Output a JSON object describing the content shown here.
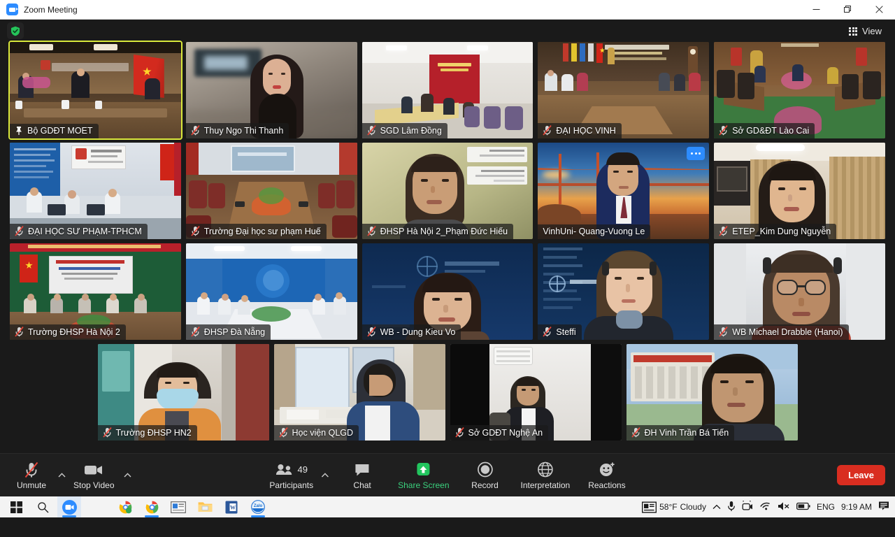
{
  "window": {
    "title": "Zoom Meeting",
    "app_icon": "zoom-video-icon",
    "minimize": "minimize-icon",
    "maximize": "restore-icon",
    "close": "close-icon"
  },
  "header": {
    "security_badge": "shield-check-icon",
    "view_label": "View",
    "view_icon": "grid-icon"
  },
  "gallery": {
    "rows": [
      [
        {
          "name": "Bộ GDĐT MOET",
          "status": "pinned",
          "active_speaker": true,
          "scene": "conf-room-flag",
          "more": false
        },
        {
          "name": "Thuy Ngo Thi Thanh",
          "status": "muted",
          "active_speaker": false,
          "scene": "person-woman-office",
          "more": false
        },
        {
          "name": "SGD Lâm Đồng",
          "status": "muted",
          "active_speaker": false,
          "scene": "room-red-banner",
          "more": false
        },
        {
          "name": "ĐẠI HỌC VINH",
          "status": "muted",
          "active_speaker": false,
          "scene": "room-vinh-univ",
          "more": false
        },
        {
          "name": "Sở GD&ĐT Lào Cai",
          "status": "muted",
          "active_speaker": false,
          "scene": "room-laocai",
          "more": false
        }
      ],
      [
        {
          "name": "ĐẠI HỌC SƯ PHẠM-TPHCM",
          "status": "muted",
          "active_speaker": false,
          "scene": "room-hcm-blue",
          "more": false
        },
        {
          "name": "Trường Đại học sư phạm Huế",
          "status": "muted",
          "active_speaker": false,
          "scene": "room-hue",
          "more": false
        },
        {
          "name": "ĐHSP Hà Nội 2_Phạm Đức Hiếu",
          "status": "muted",
          "active_speaker": false,
          "scene": "person-man-green",
          "more": false
        },
        {
          "name": "VinhUni- Quang-Vuong Le",
          "status": "unmuted",
          "active_speaker": false,
          "scene": "person-bridge-bg",
          "more": true
        },
        {
          "name": "ETEP_Kim Dung Nguyễn",
          "status": "muted",
          "active_speaker": false,
          "scene": "person-woman-curtain",
          "more": false
        }
      ],
      [
        {
          "name": "Trường ĐHSP Hà Nội 2",
          "status": "muted",
          "active_speaker": false,
          "scene": "room-banner-red",
          "more": false
        },
        {
          "name": "ĐHSP Đà Nẵng",
          "status": "muted",
          "active_speaker": false,
          "scene": "room-danang-blue",
          "more": false
        },
        {
          "name": "WB - Dung Kieu Vo",
          "status": "muted",
          "active_speaker": false,
          "scene": "person-worldbank-1",
          "more": false
        },
        {
          "name": "Steffi",
          "status": "muted",
          "active_speaker": false,
          "scene": "person-worldbank-2",
          "more": false
        },
        {
          "name": "WB Michael Drabble (Hanoi)",
          "status": "muted",
          "active_speaker": false,
          "scene": "person-glasses-headset",
          "more": false
        }
      ],
      [
        {
          "name": "Trường ĐHSP HN2",
          "status": "muted",
          "active_speaker": false,
          "scene": "person-woman-mask",
          "more": false
        },
        {
          "name": "Học viện QLGD",
          "status": "muted",
          "active_speaker": false,
          "scene": "room-desk-man",
          "more": false
        },
        {
          "name": "Sở GDĐT Nghệ An",
          "status": "muted",
          "active_speaker": false,
          "scene": "person-man-suit",
          "more": false
        },
        {
          "name": "ĐH Vinh Trần Bá Tiến",
          "status": "muted",
          "active_speaker": false,
          "scene": "person-man-building",
          "more": false
        }
      ]
    ]
  },
  "toolbar": {
    "mute": {
      "label": "Unmute",
      "icon": "microphone-muted-icon",
      "has_caret": true
    },
    "video": {
      "label": "Stop Video",
      "icon": "video-camera-icon",
      "has_caret": true
    },
    "participants": {
      "label": "Participants",
      "icon": "people-icon",
      "count": "49",
      "has_caret": true
    },
    "chat": {
      "label": "Chat",
      "icon": "chat-bubble-icon"
    },
    "share": {
      "label": "Share Screen",
      "icon": "share-arrow-up-icon",
      "accent": "#3ad07d"
    },
    "record": {
      "label": "Record",
      "icon": "record-circle-icon"
    },
    "interpretation": {
      "label": "Interpretation",
      "icon": "globe-icon"
    },
    "reactions": {
      "label": "Reactions",
      "icon": "smiley-plus-icon"
    },
    "leave": {
      "label": "Leave",
      "color": "#d92d20"
    }
  },
  "taskbar": {
    "items": [
      {
        "name": "start-button",
        "icon": "windows-logo-icon"
      },
      {
        "name": "search-button",
        "icon": "magnifier-icon"
      },
      {
        "name": "zoom-taskbar-button",
        "icon": "zoom-video-icon"
      },
      {
        "name": "chrome-green-taskbar-button",
        "icon": "chrome-icon"
      },
      {
        "name": "chrome-taskbar-button",
        "icon": "chrome-icon"
      },
      {
        "name": "news-widget-button",
        "icon": "news-panel-icon"
      },
      {
        "name": "file-explorer-button",
        "icon": "folder-icon"
      },
      {
        "name": "word-button",
        "icon": "word-icon"
      },
      {
        "name": "zalo-button",
        "icon": "zalo-icon"
      }
    ],
    "tray": {
      "weather_temp": "58°F",
      "weather_desc": "Cloudy",
      "overflow_icon": "chevron-up-icon",
      "mic_icon": "microphone-icon",
      "camera_icon": "camera-icon",
      "network_icon": "wifi-icon",
      "volume_icon": "speaker-muted-icon",
      "battery_icon": "battery-icon",
      "language": "ENG",
      "clock": "9:19 AM",
      "notification_icon": "notification-icon"
    }
  }
}
